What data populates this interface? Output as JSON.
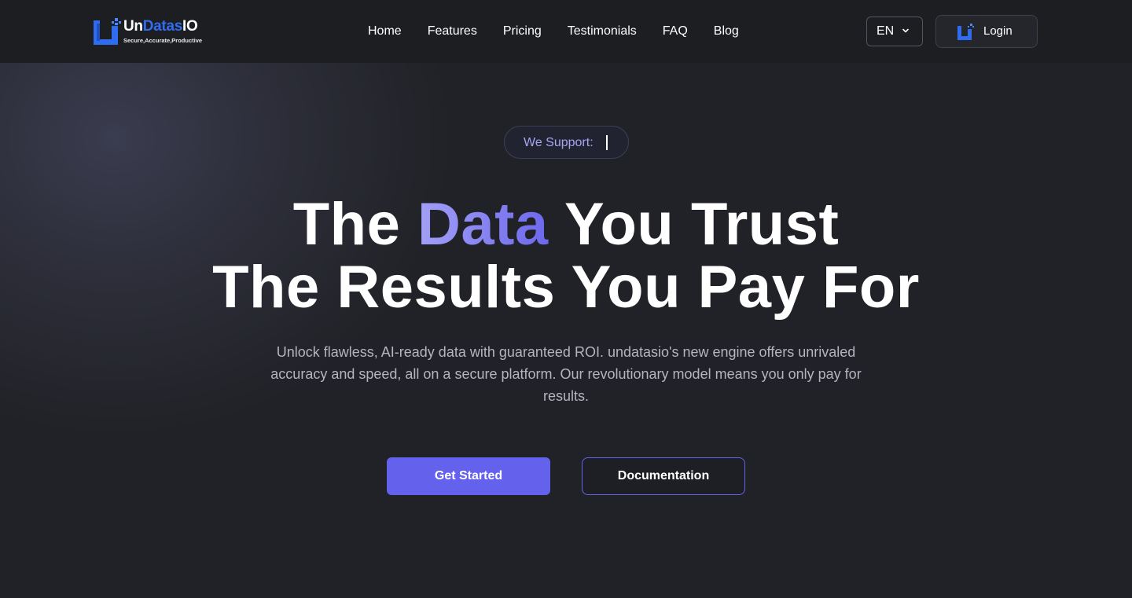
{
  "brand": {
    "name_part1": "Un",
    "name_part2": "Datas",
    "name_part3": "IO",
    "tagline": "Secure,Accurate,Productive",
    "accent_color": "#2f6cf0"
  },
  "nav": {
    "items": [
      {
        "label": "Home"
      },
      {
        "label": "Features"
      },
      {
        "label": "Pricing"
      },
      {
        "label": "Testimonials"
      },
      {
        "label": "FAQ"
      },
      {
        "label": "Blog"
      }
    ]
  },
  "header": {
    "language": "EN",
    "login_label": "Login"
  },
  "hero": {
    "support_label": "We Support:",
    "headline_line1_pre": "The ",
    "headline_line1_accent": "Data",
    "headline_line1_post": " You Trust",
    "headline_line2": "The Results You Pay For",
    "subtitle": "Unlock flawless, AI-ready data with guaranteed ROI. undatasio's new engine offers unrivaled accuracy and speed, all on a secure platform. Our revolutionary model means you only pay for results.",
    "cta_primary": "Get Started",
    "cta_secondary": "Documentation",
    "accent_color": "#6462ec"
  },
  "icons": {
    "logo": "undatasio-logo-icon",
    "language_chevron": "chevron-down-icon",
    "login_logo": "undatasio-logo-icon"
  }
}
